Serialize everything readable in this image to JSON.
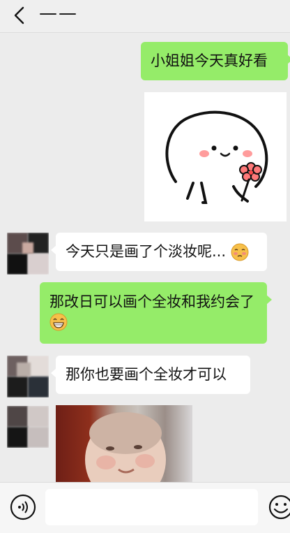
{
  "header": {
    "title": "——"
  },
  "messages": [
    {
      "direction": "out",
      "type": "text",
      "text": "小姐姐今天真好看"
    },
    {
      "direction": "out",
      "type": "sticker",
      "sticker": "cute-blob-holding-flower"
    },
    {
      "direction": "in",
      "type": "text",
      "text": "今天只是画了个淡妆呢...",
      "emoji": "shy-face"
    },
    {
      "direction": "out",
      "type": "text",
      "text": "那改日可以画个全妆和我约会了",
      "emoji": "grin-face"
    },
    {
      "direction": "in",
      "type": "text",
      "text": "那你也要画个全妆才可以"
    },
    {
      "direction": "in",
      "type": "image",
      "image": "chubby-baby-photo"
    }
  ],
  "input": {
    "value": "",
    "placeholder": ""
  },
  "icons": {
    "back": "chevron-left-icon",
    "voice": "voice-icon",
    "emoji": "emoji-icon"
  },
  "colors": {
    "outgoing_bubble": "#95ec69",
    "incoming_bubble": "#ffffff",
    "background": "#ececec"
  }
}
